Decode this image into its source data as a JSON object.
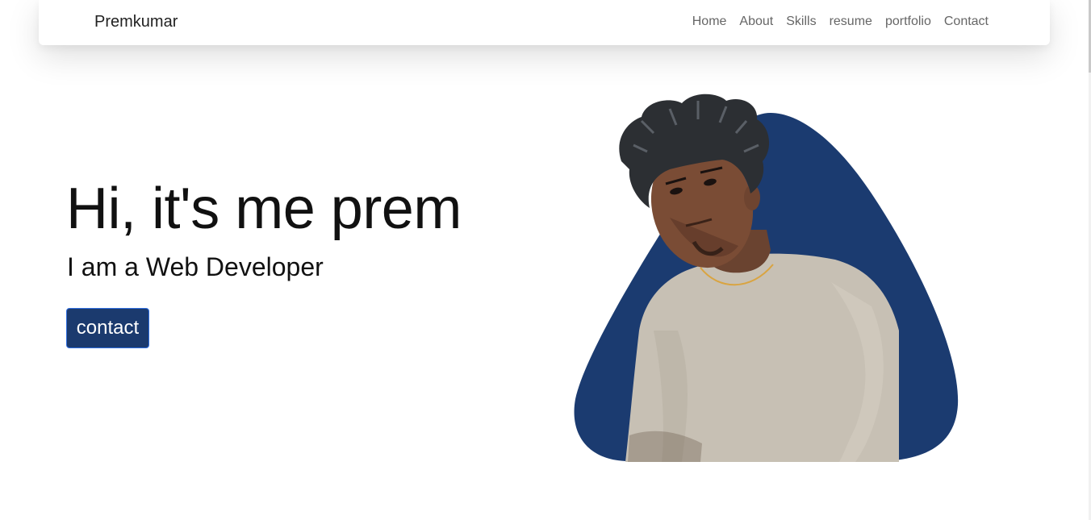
{
  "navbar": {
    "brand": "Premkumar",
    "links": [
      "Home",
      "About",
      "Skills",
      "resume",
      "portfolio",
      "Contact"
    ]
  },
  "hero": {
    "title": "Hi, it's me prem",
    "subtitle": "I am a Web Developer",
    "button_label": "contact"
  },
  "colors": {
    "accent": "#1b3a6e",
    "button_border": "#2f6ee0",
    "blob": "#1b3b70",
    "text": "#111111",
    "nav_text": "#666666"
  },
  "icons": {
    "portrait": "person-photo"
  }
}
